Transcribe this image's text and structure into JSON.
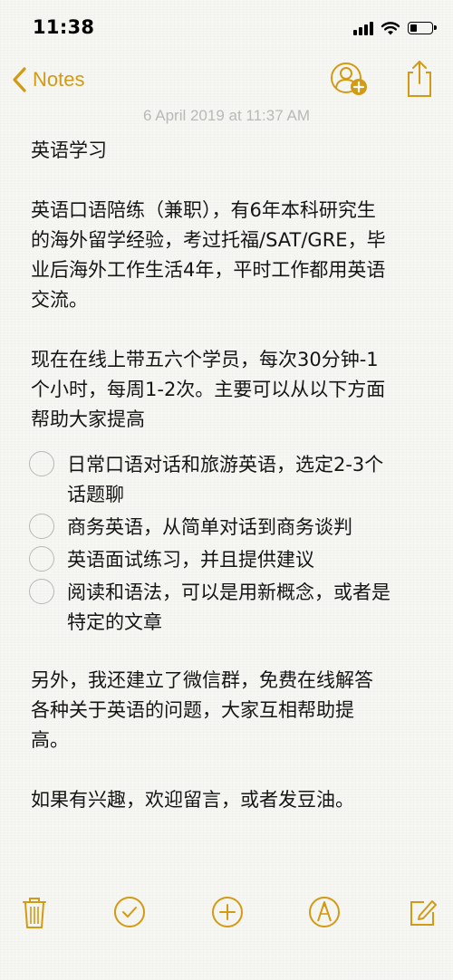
{
  "status_bar": {
    "time": "11:38",
    "icons": [
      "signal-icon",
      "wifi-icon",
      "battery-icon"
    ]
  },
  "nav": {
    "back_label": "Notes",
    "icons": [
      "chevron-left-icon",
      "add-person-icon",
      "share-icon"
    ]
  },
  "note": {
    "date": "6 April 2019 at 11:37 AM",
    "title": "英语学习",
    "intro_lines": [
      "英语口语陪练（兼职），有6年本科研究生",
      "的海外留学经验，考过托福/SAT/GRE，毕",
      "业后海外工作生活4年，平时工作都用英语",
      "交流。"
    ],
    "current_lines": [
      "现在在线上带五六个学员，每次30分钟-1",
      "个小时，每周1-2次。主要可以从以下方面",
      "帮助大家提高"
    ],
    "checklist": [
      {
        "lines": [
          "日常口语对话和旅游英语，选定2-3个",
          "话题聊"
        ],
        "checked": false
      },
      {
        "lines": [
          "商务英语，从简单对话到商务谈判"
        ],
        "checked": false
      },
      {
        "lines": [
          "英语面试练习，并且提供建议"
        ],
        "checked": false
      },
      {
        "lines": [
          "阅读和语法，可以是用新概念，或者是",
          "特定的文章"
        ],
        "checked": false
      }
    ],
    "wechat_lines": [
      "另外，我还建立了微信群，免费在线解答",
      "各种关于英语的问题，大家互相帮助提",
      "高。"
    ],
    "closing": "如果有兴趣，欢迎留言，或者发豆油。"
  },
  "toolbar": {
    "icons": [
      "trash-icon",
      "checklist-icon",
      "add-icon",
      "markup-icon",
      "compose-icon"
    ]
  },
  "colors": {
    "accent": "#d39a13",
    "date_text": "#b9b9b9",
    "body_text": "#151515",
    "checkbox_border": "#b8b8b8"
  }
}
